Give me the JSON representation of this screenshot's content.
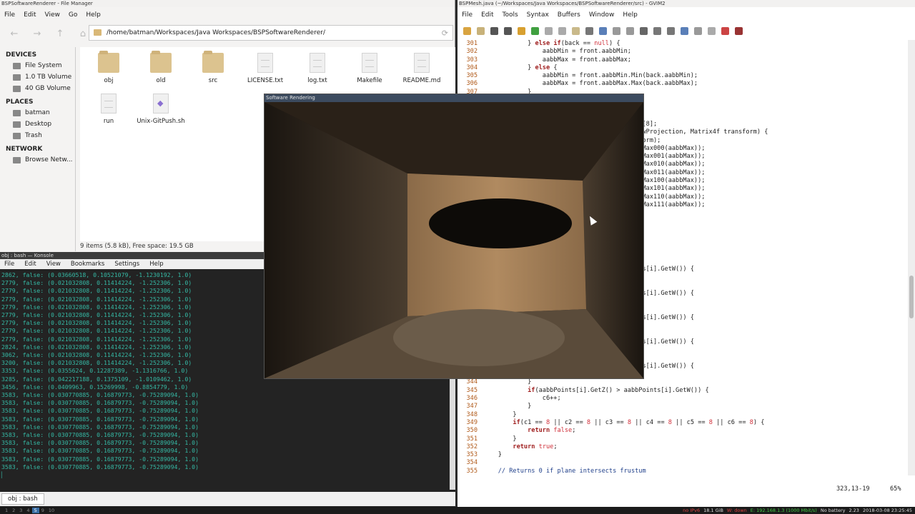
{
  "file_manager": {
    "title": "BSPSoftwareRenderer - File Manager",
    "menu": [
      "File",
      "Edit",
      "View",
      "Go",
      "Help"
    ],
    "path": "/home/batman/Workspaces/Java Workspaces/BSPSoftwareRenderer/",
    "sections": [
      {
        "header": "DEVICES",
        "items": [
          "File System",
          "1.0 TB Volume",
          "40 GB Volume"
        ]
      },
      {
        "header": "PLACES",
        "items": [
          "batman",
          "Desktop",
          "Trash"
        ]
      },
      {
        "header": "NETWORK",
        "items": [
          "Browse Netw..."
        ]
      }
    ],
    "files": [
      {
        "name": "obj",
        "kind": "folder"
      },
      {
        "name": "old",
        "kind": "folder"
      },
      {
        "name": "src",
        "kind": "folder"
      },
      {
        "name": "LICENSE.txt",
        "kind": "doc"
      },
      {
        "name": "log.txt",
        "kind": "doc"
      },
      {
        "name": "Makefile",
        "kind": "doc"
      },
      {
        "name": "README.md",
        "kind": "doc"
      },
      {
        "name": "run",
        "kind": "doc"
      },
      {
        "name": "Unix-GitPush.sh",
        "kind": "sh"
      }
    ],
    "status": "9 items (5.8 kB), Free space: 19.5 GB"
  },
  "konsole": {
    "title": "obj : bash — Konsole",
    "menu": [
      "File",
      "Edit",
      "View",
      "Bookmarks",
      "Settings",
      "Help"
    ],
    "lines": [
      "2862, false: (0.03660518, 0.10521079, -1.1230192, 1.0)",
      "2779, false: (0.021032808, 0.11414224, -1.252306, 1.0)",
      "2779, false: (0.021032808, 0.11414224, -1.252306, 1.0)",
      "2779, false: (0.021032808, 0.11414224, -1.252306, 1.0)",
      "2779, false: (0.021032808, 0.11414224, -1.252306, 1.0)",
      "2779, false: (0.021032808, 0.11414224, -1.252306, 1.0)",
      "2779, false: (0.021032808, 0.11414224, -1.252306, 1.0)",
      "2779, false: (0.021032808, 0.11414224, -1.252306, 1.0)",
      "2779, false: (0.021032808, 0.11414224, -1.252306, 1.0)",
      "2824, false: (0.021032808, 0.11414224, -1.252306, 1.0)",
      "3062, false: (0.021032808, 0.11414224, -1.252306, 1.0)",
      "3200, false: (0.021032808, 0.11414224, -1.252306, 1.0)",
      "3353, false: (0.0355624, 0.12287389, -1.1316766, 1.0)",
      "3285, false: (0.042217188, 0.1375109, -1.0109462, 1.0)",
      "3456, false: (0.0409963, 0.15269998, -0.8854779, 1.0)",
      "3583, false: (0.030770885, 0.16879773, -0.75289094, 1.0)",
      "3583, false: (0.030770885, 0.16879773, -0.75289094, 1.0)",
      "3583, false: (0.030770885, 0.16879773, -0.75289094, 1.0)",
      "3583, false: (0.030770885, 0.16879773, -0.75289094, 1.0)",
      "3583, false: (0.030770885, 0.16879773, -0.75289094, 1.0)",
      "3583, false: (0.030770885, 0.16879773, -0.75289094, 1.0)",
      "3583, false: (0.030770885, 0.16879773, -0.75289094, 1.0)",
      "3583, false: (0.030770885, 0.16879773, -0.75289094, 1.0)",
      "3583, false: (0.030770885, 0.16879773, -0.75289094, 1.0)",
      "3583, false: (0.030770885, 0.16879773, -0.75289094, 1.0)",
      "▏"
    ],
    "tab_label": "obj : bash"
  },
  "vim": {
    "title": "BSPMesh.java (~/Workspaces/Java Workspaces/BSPSoftwareRenderer/src) - GVIM2",
    "menu": [
      "File",
      "Edit",
      "Tools",
      "Syntax",
      "Buffers",
      "Window",
      "Help"
    ],
    "lines": [
      {
        "n": "301",
        "t": "            } else if(back == null) {"
      },
      {
        "n": "302",
        "t": "                aabbMin = front.aabbMin;"
      },
      {
        "n": "303",
        "t": "                aabbMax = front.aabbMax;"
      },
      {
        "n": "304",
        "t": "            } else {"
      },
      {
        "n": "305",
        "t": "                aabbMin = front.aabbMin.Min(back.aabbMin);"
      },
      {
        "n": "306",
        "t": "                aabbMax = front.aabbMax.Max(back.aabbMax);"
      },
      {
        "n": "307",
        "t": "            }"
      },
      {
        "n": "",
        "t": ""
      },
      {
        "n": "",
        "t": ""
      },
      {
        "n": "",
        "t": ""
      },
      {
        "n": "",
        "t": "                                       or4f[8];"
      },
      {
        "n": "",
        "t": "                                        viewProjection, Matrix4f transform) {"
      },
      {
        "n": "",
        "t": "                                       ansform);"
      },
      {
        "n": "",
        "t": "                                       .MinMax000(aabbMax));"
      },
      {
        "n": "",
        "t": "                                       .MinMax001(aabbMax));"
      },
      {
        "n": "",
        "t": "                                       .MinMax010(aabbMax));"
      },
      {
        "n": "",
        "t": "                                       .MinMax011(aabbMax));"
      },
      {
        "n": "",
        "t": "                                       .MinMax100(aabbMax));"
      },
      {
        "n": "",
        "t": "                                       .MinMax101(aabbMax));"
      },
      {
        "n": "",
        "t": "                                       .MinMax110(aabbMax));"
      },
      {
        "n": "",
        "t": "                                       .MinMax111(aabbMax));"
      },
      {
        "n": "",
        "t": ""
      },
      {
        "n": "",
        "t": ""
      },
      {
        "n": "",
        "t": ""
      },
      {
        "n": "",
        "t": ""
      },
      {
        "n": "",
        "t": ""
      },
      {
        "n": "",
        "t": ""
      },
      {
        "n": "",
        "t": ""
      },
      {
        "n": "",
        "t": "                                       oints[i].GetW()) {"
      },
      {
        "n": "",
        "t": ""
      },
      {
        "n": "",
        "t": ""
      },
      {
        "n": "",
        "t": "                                       oints[i].GetW()) {"
      },
      {
        "n": "",
        "t": ""
      },
      {
        "n": "",
        "t": ""
      },
      {
        "n": "",
        "t": "                                       oints[i].GetW()) {"
      },
      {
        "n": "",
        "t": ""
      },
      {
        "n": "",
        "t": ""
      },
      {
        "n": "",
        "t": "                                       oints[i].GetW()) {"
      },
      {
        "n": "",
        "t": ""
      },
      {
        "n": "",
        "t": ""
      },
      {
        "n": "",
        "t": "                                       oints[i].GetW()) {"
      },
      {
        "n": "343",
        "t": "                c5++;"
      },
      {
        "n": "344",
        "t": "            }"
      },
      {
        "n": "345",
        "t": "            if(aabbPoints[i].GetZ() > aabbPoints[i].GetW()) {"
      },
      {
        "n": "346",
        "t": "                c6++;"
      },
      {
        "n": "347",
        "t": "            }"
      },
      {
        "n": "348",
        "t": "        }"
      },
      {
        "n": "349",
        "t": "        if(c1 == 8 || c2 == 8 || c3 == 8 || c4 == 8 || c5 == 8 || c6 == 8) {"
      },
      {
        "n": "350",
        "t": "            return false;"
      },
      {
        "n": "351",
        "t": "        }"
      },
      {
        "n": "352",
        "t": "        return true;"
      },
      {
        "n": "353",
        "t": "    }"
      },
      {
        "n": "354",
        "t": ""
      },
      {
        "n": "355",
        "t": "    // Returns 0 if plane intersects frustum"
      }
    ],
    "status_pos": "323,13-19",
    "status_pct": "65%"
  },
  "render_window": {
    "title": "Software Rendering"
  },
  "panel": {
    "workspaces": [
      "1",
      "2",
      "3",
      "4",
      "5",
      "9",
      "10"
    ],
    "active_workspace": "5",
    "status": [
      "no IPv6",
      "18.1 GiB",
      "W: down",
      "E: 192.168.1.3 (1000 Mbit/s)",
      "No battery",
      "2.23",
      "2018-03-08 23:25:45"
    ]
  }
}
